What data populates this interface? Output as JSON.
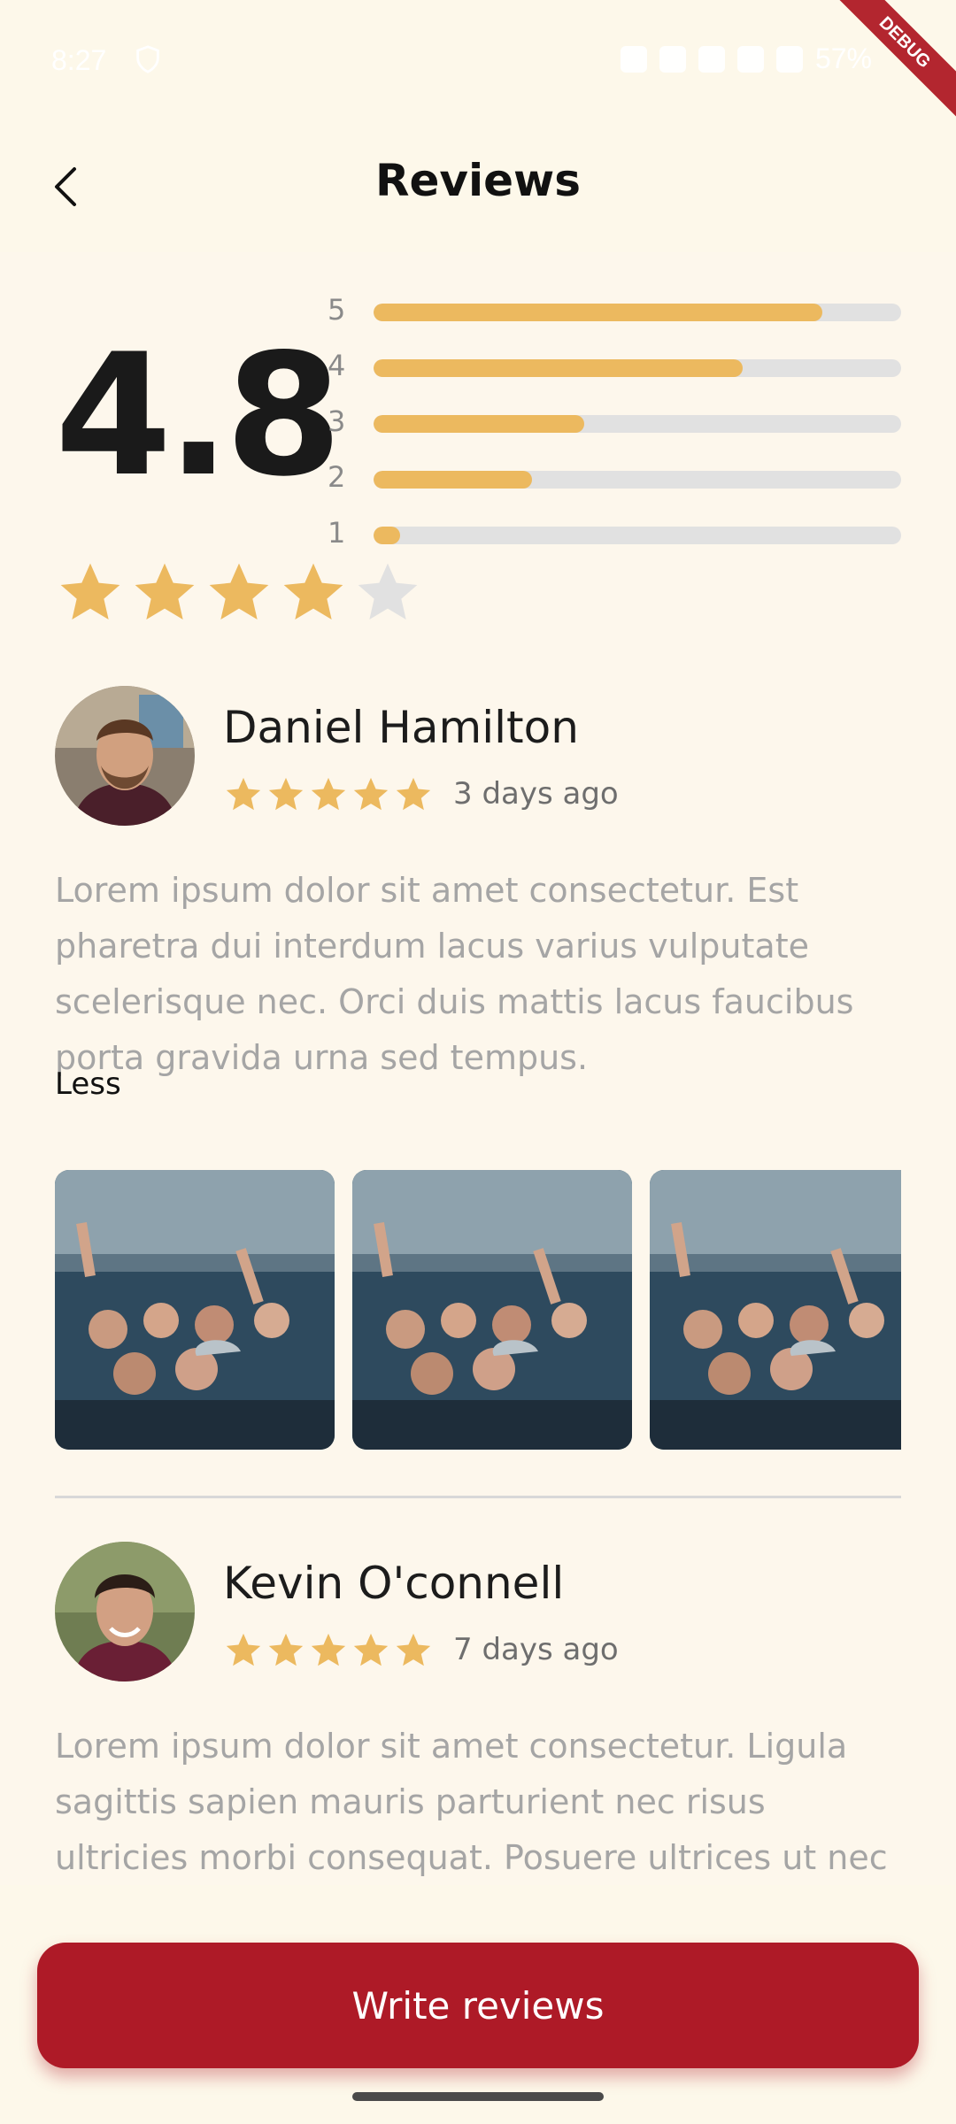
{
  "status_bar": {
    "time": "8:27",
    "battery": "57%",
    "debug_label": "DEBUG"
  },
  "header": {
    "title": "Reviews",
    "back_icon": "chevron-left-icon"
  },
  "summary": {
    "average": "4.8",
    "stars_filled": 4,
    "stars_total": 5,
    "distribution": [
      {
        "label": "5",
        "fraction": 0.85
      },
      {
        "label": "4",
        "fraction": 0.7
      },
      {
        "label": "3",
        "fraction": 0.4
      },
      {
        "label": "2",
        "fraction": 0.3
      },
      {
        "label": "1",
        "fraction": 0.05
      }
    ]
  },
  "reviews": [
    {
      "name": "Daniel Hamilton",
      "stars": 5,
      "date": "3 days ago",
      "text": "Lorem ipsum dolor sit amet consectetur. Est pharetra dui interdum lacus varius vulputate scelerisque nec. Orci duis mattis lacus faucibus porta gravida urna sed tempus.",
      "toggle": "Less"
    },
    {
      "name": "Kevin O'connell",
      "stars": 5,
      "date": "7 days ago",
      "text": "Lorem ipsum dolor sit amet consectetur. Ligula sagittis sapien mauris parturient nec risus ultricies morbi consequat. Posuere ultrices ut nec"
    }
  ],
  "cta": {
    "label": "Write reviews"
  },
  "colors": {
    "background": "#fdf7ec",
    "accent": "#ae1a27",
    "star": "#ecb95f",
    "star_empty": "#e1e1e1"
  }
}
